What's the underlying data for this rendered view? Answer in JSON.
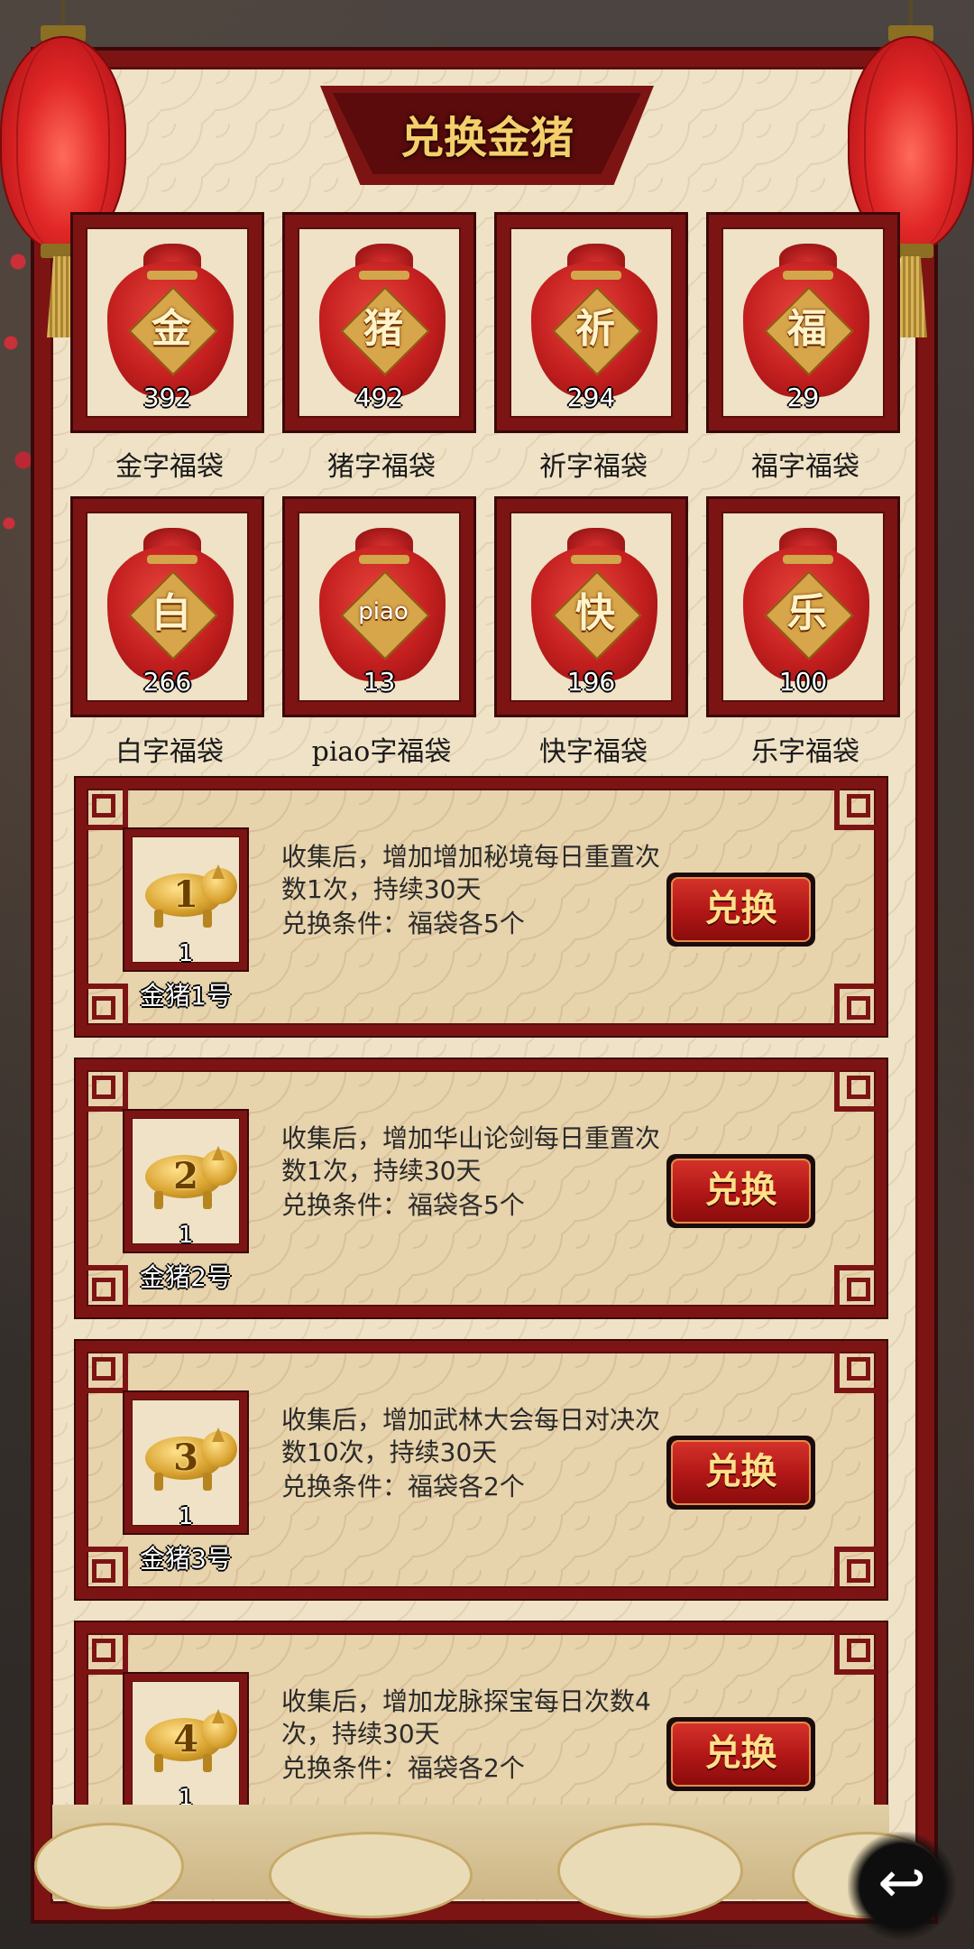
{
  "title": "兑换金猪",
  "bags": [
    {
      "glyph": "金",
      "count": "392",
      "label": "金字福袋"
    },
    {
      "glyph": "猪",
      "count": "492",
      "label": "猪字福袋"
    },
    {
      "glyph": "祈",
      "count": "294",
      "label": "祈字福袋"
    },
    {
      "glyph": "福",
      "count": "29",
      "label": "福字福袋"
    },
    {
      "glyph": "白",
      "count": "266",
      "label": "白字福袋"
    },
    {
      "glyph": "piao",
      "count": "13",
      "label": "piao字福袋"
    },
    {
      "glyph": "快",
      "count": "196",
      "label": "快字福袋"
    },
    {
      "glyph": "乐",
      "count": "100",
      "label": "乐字福袋"
    }
  ],
  "pigs": [
    {
      "num": "1",
      "count": "1",
      "name": "金猪1号",
      "desc": "收集后，增加增加秘境每日重置次数1次，持续30天",
      "cond": "兑换条件：福袋各5个",
      "button": "兑换"
    },
    {
      "num": "2",
      "count": "1",
      "name": "金猪2号",
      "desc": "收集后，增加华山论剑每日重置次数1次，持续30天",
      "cond": "兑换条件：福袋各5个",
      "button": "兑换"
    },
    {
      "num": "3",
      "count": "1",
      "name": "金猪3号",
      "desc": "收集后，增加武林大会每日对决次数10次，持续30天",
      "cond": "兑换条件：福袋各2个",
      "button": "兑换"
    },
    {
      "num": "4",
      "count": "1",
      "name": "",
      "desc": "收集后，增加龙脉探宝每日次数4次，持续30天",
      "cond": "兑换条件：福袋各2个",
      "button": "兑换"
    }
  ],
  "back_icon": "return-arrow-icon",
  "colors": {
    "frame": "#7d1414",
    "parchment": "#efe2c6",
    "gold_text": "#f5cf6a"
  }
}
